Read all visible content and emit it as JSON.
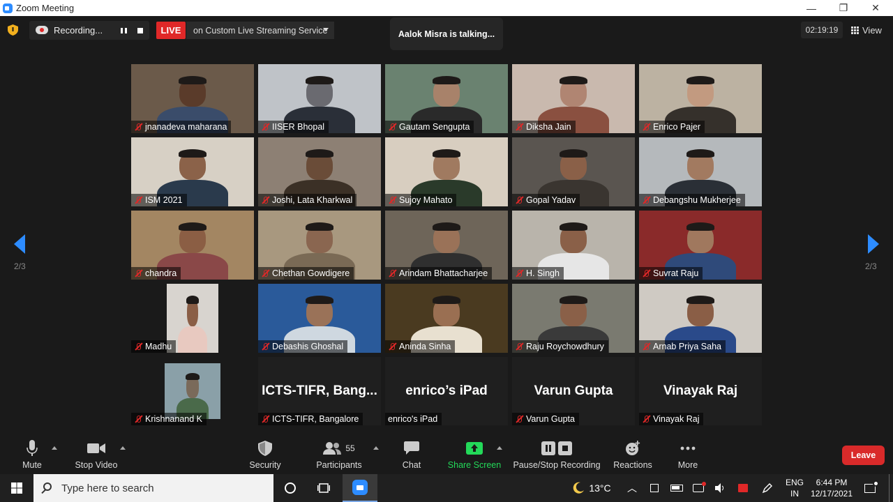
{
  "window": {
    "title": "Zoom Meeting",
    "minimize": "—",
    "maximize": "❐",
    "close": "✕"
  },
  "topbar": {
    "recording_label": "Recording...",
    "live_badge": "LIVE",
    "live_service": "on Custom Live Streaming Service",
    "talking": "Aalok Misra is talking...",
    "timer": "02:19:19",
    "view_label": "View"
  },
  "pager": {
    "left": "2/3",
    "right": "2/3"
  },
  "participants": [
    {
      "name": "jnanadeva maharana",
      "bg": "#6b5a4a",
      "skin": "#5a3b2a",
      "shirt": "#3a4c6a"
    },
    {
      "name": "IISER Bhopal",
      "bg": "#bfc3c8",
      "skin": "#6a6a70",
      "shirt": "#2a2f38"
    },
    {
      "name": "Gautam Sengupta",
      "bg": "#6a8270",
      "skin": "#a8826a",
      "shirt": "#2a2a2a"
    },
    {
      "name": "Diksha Jain",
      "bg": "#c9b9ae",
      "skin": "#b08572",
      "shirt": "#8a5040"
    },
    {
      "name": "Enrico Pajer",
      "bg": "#bcb2a2",
      "skin": "#c29a80",
      "shirt": "#35302b"
    },
    {
      "name": "ISM 2021",
      "bg": "#d7d0c5",
      "skin": "#8b6249",
      "shirt": "#2a3a4c"
    },
    {
      "name": "Joshi, Lata Kharkwal",
      "bg": "#8d8074",
      "skin": "#6a4c38",
      "shirt": "#3b3026"
    },
    {
      "name": "Sujoy Mahato",
      "bg": "#d8cec0",
      "skin": "#a07a60",
      "shirt": "#2a3a2a"
    },
    {
      "name": "Gopal Yadav",
      "bg": "#5a5550",
      "skin": "#8a6048",
      "shirt": "#3a3530"
    },
    {
      "name": "Debangshu Mukherjee",
      "bg": "#b5b9bc",
      "skin": "#a27a60",
      "shirt": "#2a2f36"
    },
    {
      "name": "chandra",
      "bg": "#a38662",
      "skin": "#8b5e44",
      "shirt": "#8a4848"
    },
    {
      "name": "Chethan Gowdigere",
      "bg": "#a8987f",
      "skin": "#8a6650",
      "shirt": "#7a6a55"
    },
    {
      "name": "Arindam Bhattacharjee",
      "bg": "#6e6559",
      "skin": "#9a7258",
      "shirt": "#2f2f2f"
    },
    {
      "name": "H. Singh",
      "bg": "#b9b4ab",
      "skin": "#8a6048",
      "shirt": "#e6e6e6"
    },
    {
      "name": "Suvrat Raju",
      "bg": "#8a2a2a",
      "skin": "#a0785e",
      "shirt": "#2f4a7a"
    },
    {
      "name": "Madhu",
      "bg": "#1a1a1a",
      "skin": "#8a5e46",
      "shirt": "#e8c9c0",
      "framed": true
    },
    {
      "name": "Debashis Ghoshal",
      "bg": "#2a5a9a",
      "skin": "#9a7258",
      "shirt": "#cfd8e0"
    },
    {
      "name": "Aninda Sinha",
      "bg": "#4a3a20",
      "skin": "#9a6f52",
      "shirt": "#e8e0d0"
    },
    {
      "name": "Raju Roychowdhury",
      "bg": "#7a7a70",
      "skin": "#8a6048",
      "shirt": "#3a3a3a"
    },
    {
      "name": "Arnab Priya Saha",
      "bg": "#cfcac3",
      "skin": "#8a5e46",
      "shirt": "#2a4a8a"
    },
    {
      "name": "Krishnanand K",
      "bg": "#1a1a1a",
      "skin": "#7a6a5a",
      "shirt": "#4a6a4a",
      "framed": true
    },
    {
      "name": "ICTS-TIFR, Bangalore",
      "display": "ICTS-TIFR,  Bang...",
      "bg": "#1f1f1f",
      "textonly": true
    },
    {
      "name": "enrico's iPad",
      "display": "enrico’s iPad",
      "bg": "#1f1f1f",
      "textonly": true,
      "nomic": true
    },
    {
      "name": "Varun Gupta",
      "display": "Varun Gupta",
      "bg": "#1f1f1f",
      "textonly": true
    },
    {
      "name": "Vinayak Raj",
      "display": "Vinayak Raj",
      "bg": "#1f1f1f",
      "textonly": true
    }
  ],
  "toolbar": {
    "mute": "Mute",
    "stop_video": "Stop Video",
    "security": "Security",
    "participants": "Participants",
    "participant_count": "55",
    "chat": "Chat",
    "share_screen": "Share Screen",
    "pause_stop_recording": "Pause/Stop Recording",
    "reactions": "Reactions",
    "more": "More",
    "leave": "Leave"
  },
  "taskbar": {
    "search_placeholder": "Type here to search",
    "temperature": "13°C",
    "lang_top": "ENG",
    "lang_bottom": "IN",
    "time": "6:44 PM",
    "date": "12/17/2021"
  },
  "colors": {
    "accent": "#2d8cff",
    "live": "#e02828",
    "share": "#23d959",
    "leave": "#d92a2a"
  }
}
